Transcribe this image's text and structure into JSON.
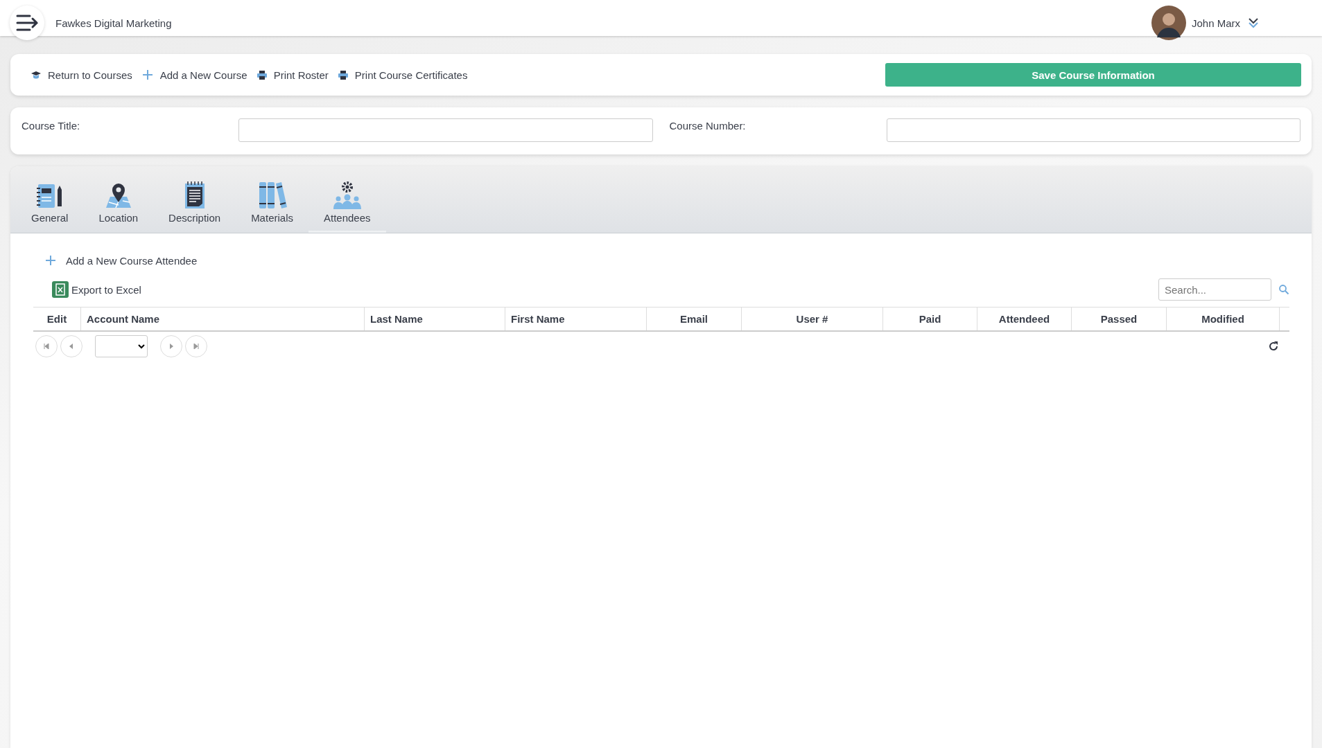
{
  "header": {
    "company": "Fawkes Digital Marketing",
    "user_name": "John Marx"
  },
  "toolbar": {
    "links": [
      {
        "kind": "cap",
        "label": "Return to Courses"
      },
      {
        "kind": "plus",
        "label": "Add a New Course"
      },
      {
        "kind": "printer",
        "label": "Print Roster"
      },
      {
        "kind": "printer",
        "label": "Print Course Certificates"
      }
    ],
    "save_button": "Save Course Information"
  },
  "fields": [
    {
      "label": "Course Title:"
    },
    {
      "label": "Course Number:"
    }
  ],
  "tabs": [
    {
      "kind": "notebook",
      "label": "General",
      "selected": false
    },
    {
      "kind": "map",
      "label": "Location",
      "selected": false
    },
    {
      "kind": "document",
      "label": "Description",
      "selected": false
    },
    {
      "kind": "books",
      "label": "Materials",
      "selected": false
    },
    {
      "kind": "people",
      "label": "Attendees",
      "selected": true
    }
  ],
  "actions": {
    "add": "Add a New Course Attendee",
    "export": "Export to Excel",
    "search_placeholder": "Search..."
  },
  "table": {
    "columns": [
      "Edit",
      "Account Name",
      "Last Name",
      "First Name",
      "Email",
      "User #",
      "Paid",
      "Attendeed",
      "Passed",
      "Modified"
    ]
  }
}
